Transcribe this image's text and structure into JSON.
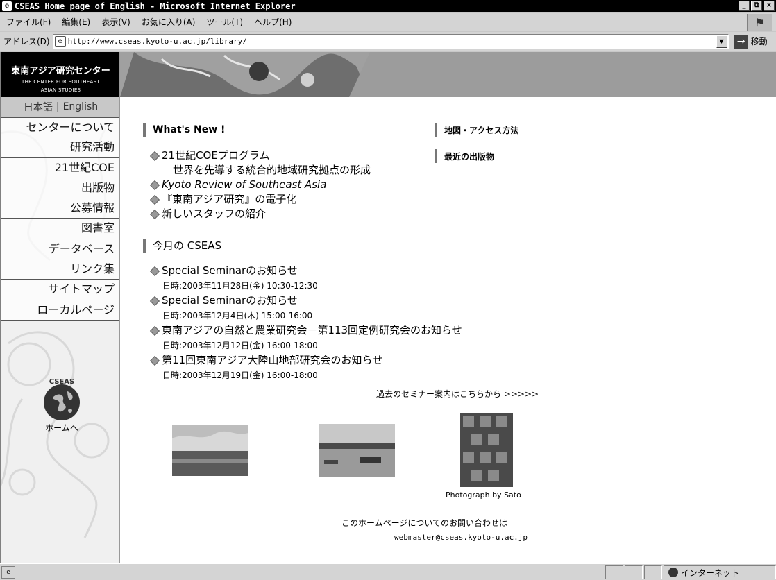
{
  "window": {
    "title": "CSEAS Home page of English - Microsoft Internet Explorer",
    "buttons": [
      "_",
      "⧉",
      "×"
    ]
  },
  "menu": {
    "items": [
      "ファイル(F)",
      "編集(E)",
      "表示(V)",
      "お気に入り(A)",
      "ツール(T)",
      "ヘルプ(H)"
    ]
  },
  "address": {
    "label": "アドレス(D)",
    "url": "http://www.cseas.kyoto-u.ac.jp/library/",
    "go_label": "移動"
  },
  "sidebar": {
    "logo_jp": "東南アジア研究センター",
    "logo_en_1": "THE CENTER FOR SOUTHEAST",
    "logo_en_2": "ASIAN STUDIES",
    "lang_jp": "日本語",
    "lang_sep": "|",
    "lang_en": "English",
    "nav": [
      "センターについて",
      "研究活動",
      "21世紀COE",
      "出版物",
      "公募情報",
      "図書室",
      "データベース",
      "リンク集",
      "サイトマップ",
      "ローカルページ"
    ],
    "home_caption": "CSEAS",
    "home_label": "ホームへ"
  },
  "main": {
    "whats_new_title": "What's New !",
    "news": [
      {
        "line1": "21世紀COEプログラム",
        "line2": "世界を先導する統合的地域研究拠点の形成"
      },
      {
        "line1": "Kyoto Review of Southeast Asia"
      },
      {
        "line1": "『東南アジア研究』の電子化"
      },
      {
        "line1": "新しいスタッフの紹介"
      }
    ],
    "month_title": "今月の CSEAS",
    "seminars": [
      {
        "title": "Special Seminarのお知らせ",
        "date": "日時:2003年11月28日(金) 10:30-12:30"
      },
      {
        "title": "Special Seminarのお知らせ",
        "date": "日時:2003年12月4日(木) 15:00-16:00"
      },
      {
        "title": "東南アジアの自然と農業研究会－第113回定例研究会のお知らせ",
        "date": "日時:2003年12月12日(金) 16:00-18:00"
      },
      {
        "title": "第11回東南アジア大陸山地部研究会のお知らせ",
        "date": "日時:2003年12月19日(金) 16:00-18:00"
      }
    ],
    "past_link": "過去のセミナー案内はこちらから >>>>>",
    "photo_caption": "Photograph by Sato",
    "contact": "このホームページについてのお問い合わせは",
    "email": "webmaster@cseas.kyoto-u.ac.jp",
    "right_links": [
      "地図・アクセス方法",
      "最近の出版物"
    ]
  },
  "status": {
    "zone": "インターネット"
  }
}
